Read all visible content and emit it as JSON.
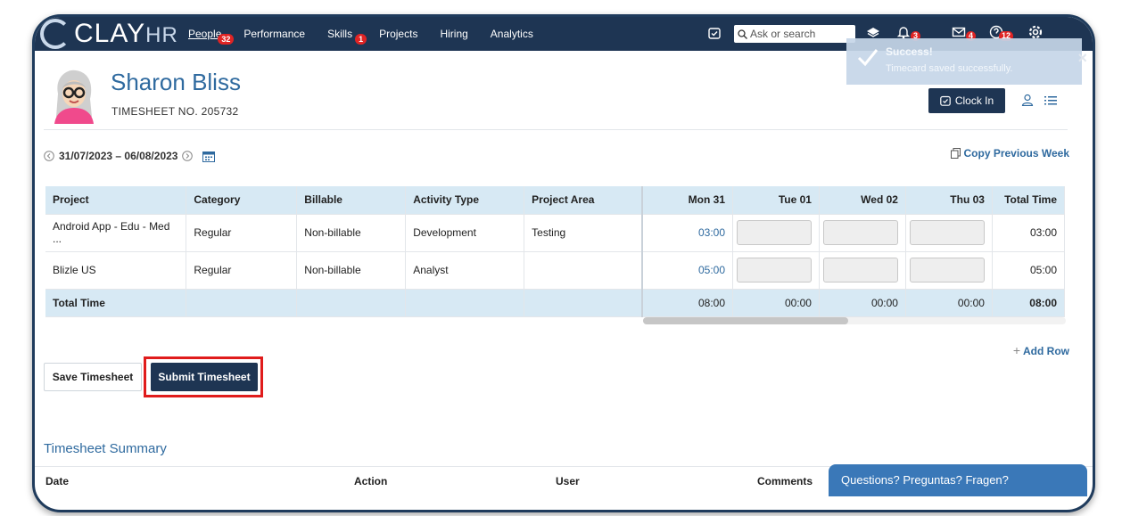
{
  "app": {
    "logo_main": "CLAY",
    "logo_sub": "HR"
  },
  "nav": {
    "items": [
      {
        "label": "People",
        "badge": "32"
      },
      {
        "label": "Performance",
        "badge": ""
      },
      {
        "label": "Skills",
        "badge": "1"
      },
      {
        "label": "Projects",
        "badge": ""
      },
      {
        "label": "Hiring",
        "badge": ""
      },
      {
        "label": "Analytics",
        "badge": ""
      }
    ],
    "search_placeholder": "Ask or search",
    "badges": {
      "notifications": "3",
      "messages": "4",
      "help": "12"
    }
  },
  "toast": {
    "title": "Success!",
    "message": "Timecard saved successfully."
  },
  "profile": {
    "name": "Sharon Bliss",
    "timesheet_no": "TIMESHEET NO. 205732",
    "clock_in_label": "Clock In"
  },
  "period": {
    "range": "31/07/2023 – 06/08/2023",
    "copy_label": "Copy Previous Week"
  },
  "table": {
    "headers": [
      "Project",
      "Category",
      "Billable",
      "Activity Type",
      "Project Area",
      "Mon 31",
      "Tue 01",
      "Wed 02",
      "Thu 03",
      "Total Time"
    ],
    "rows": [
      {
        "project": "Android App - Edu - Med ...",
        "category": "Regular",
        "billable": "Non-billable",
        "activity": "Development",
        "area": "Testing",
        "mon": "03:00",
        "total": "03:00"
      },
      {
        "project": "Blizle US",
        "category": "Regular",
        "billable": "Non-billable",
        "activity": "Analyst",
        "area": "",
        "mon": "05:00",
        "total": "05:00"
      }
    ],
    "total_row": {
      "label": "Total Time",
      "mon": "08:00",
      "tue": "00:00",
      "wed": "00:00",
      "thu": "00:00",
      "total": "08:00"
    }
  },
  "actions": {
    "add_row": "Add Row",
    "save": "Save Timesheet",
    "submit": "Submit Timesheet"
  },
  "summary": {
    "title": "Timesheet Summary",
    "columns": [
      "Date",
      "Action",
      "User",
      "Comments"
    ]
  },
  "chat": {
    "label": "Questions? Preguntas? Fragen?"
  },
  "colors": {
    "nav_bg": "#1e3553",
    "accent": "#2f6a9f",
    "header_row": "#d7e9f4",
    "highlight": "#e01c1c"
  }
}
